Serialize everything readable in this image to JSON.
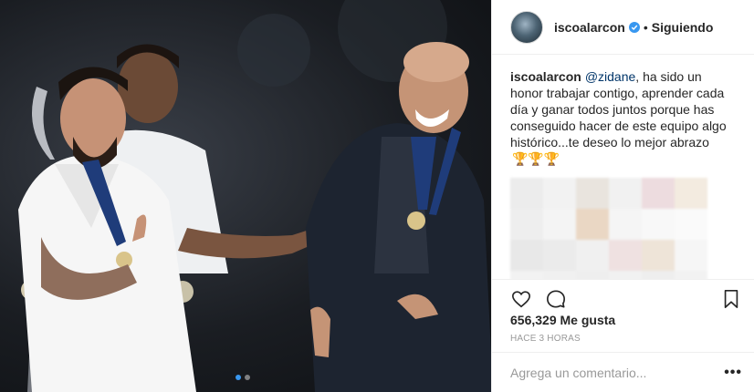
{
  "post": {
    "photo_alt": "",
    "carousel": {
      "count": 2,
      "active": 0
    }
  },
  "header": {
    "username": "iscoalarcon",
    "separator": "•",
    "follow_state": "Siguiendo"
  },
  "caption": {
    "username": "iscoalarcon",
    "mention": "@zidane",
    "text": ", ha sido un honor trabajar contigo, aprender cada día y ganar todos juntos porque has conseguido hacer de este equipo algo histórico...te deseo lo mejor abrazo",
    "trophies": "🏆🏆🏆"
  },
  "blurred_comments_colors": [
    "#ececec",
    "#f2f2f2",
    "#e9e4de",
    "#f1f1f1",
    "#eddcdf",
    "#f3ebe0",
    "#eeeeee",
    "#f4f4f4",
    "#ead7c4",
    "#f5f5f5",
    "#f8f8f8",
    "#fafafa",
    "#e8e8e8",
    "#ebebeb",
    "#f0f0f0",
    "#efe1e1",
    "#eee4d8",
    "#f6f6f6",
    "#f2f2f2",
    "#f0f0f0",
    "#eeeeee",
    "#f1f1f1",
    "#eeeeee",
    "#f2f2f2"
  ],
  "actions": {
    "like_icon": "heart-icon",
    "comment_icon": "comment-icon",
    "save_icon": "bookmark-icon"
  },
  "likes": "656,329 Me gusta",
  "timestamp": "HACE 3 HORAS",
  "add_comment": {
    "placeholder": "Agrega un comentario...",
    "more": "•••"
  },
  "colors": {
    "verified": "#3897f0",
    "mention": "#003569",
    "muted": "#999999",
    "border": "#efefef"
  }
}
